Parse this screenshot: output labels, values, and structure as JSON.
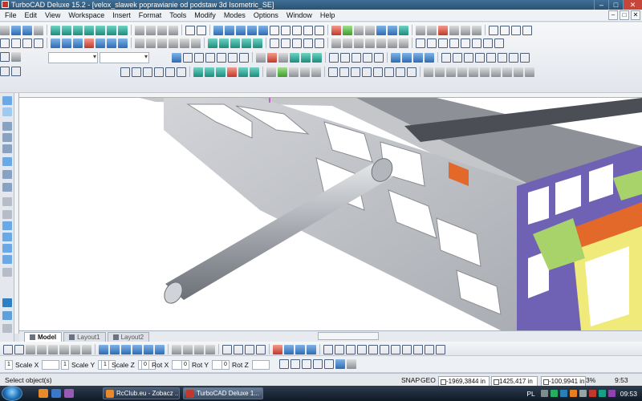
{
  "window": {
    "title": "TurboCAD Deluxe 15.2 - [velox_slawek poprawianie od podstaw 3d Isometric_SE]",
    "controls": {
      "minimize": "–",
      "maximize": "□",
      "close": "✕"
    }
  },
  "menu": [
    "File",
    "Edit",
    "View",
    "Workspace",
    "Insert",
    "Format",
    "Tools",
    "Modify",
    "Modes",
    "Options",
    "Window",
    "Help"
  ],
  "mdi_controls": [
    "–",
    "□",
    "✕"
  ],
  "layout_tabs": [
    {
      "label": "Model",
      "active": true
    },
    {
      "label": "Layout1",
      "active": false
    },
    {
      "label": "Layout2",
      "active": false
    }
  ],
  "inspector": {
    "fields": [
      {
        "label": "Scale X",
        "value": "1"
      },
      {
        "label": "Scale Y",
        "value": "1"
      },
      {
        "label": "Scale Z",
        "value": "1"
      },
      {
        "label": "Rot X",
        "value": "0"
      },
      {
        "label": "Rot Y",
        "value": "0"
      },
      {
        "label": "Rot Z",
        "value": "0"
      }
    ]
  },
  "status": {
    "prompt": "Select object(s)",
    "snap": "SNAP",
    "geo": "GEO",
    "x": "-1969,3844 in",
    "y": "1425,417 in",
    "z": "-100,9941 in",
    "zoom": "3%",
    "time": "9:53"
  },
  "taskbar": {
    "tasks": [
      {
        "label": "RcClub.eu - Zobacz ...",
        "active": false
      },
      {
        "label": "TurboCAD Deluxe 1...",
        "active": true
      }
    ],
    "language": "PL",
    "clock": "09:53"
  },
  "colors": {
    "frame_grey": "#b9bcc1",
    "frame_purple": "#6f62b5",
    "frame_orange": "#e2692a",
    "frame_yellow": "#f0ea7a",
    "frame_lime": "#a8d36a",
    "rod": "#9a9ea5"
  }
}
